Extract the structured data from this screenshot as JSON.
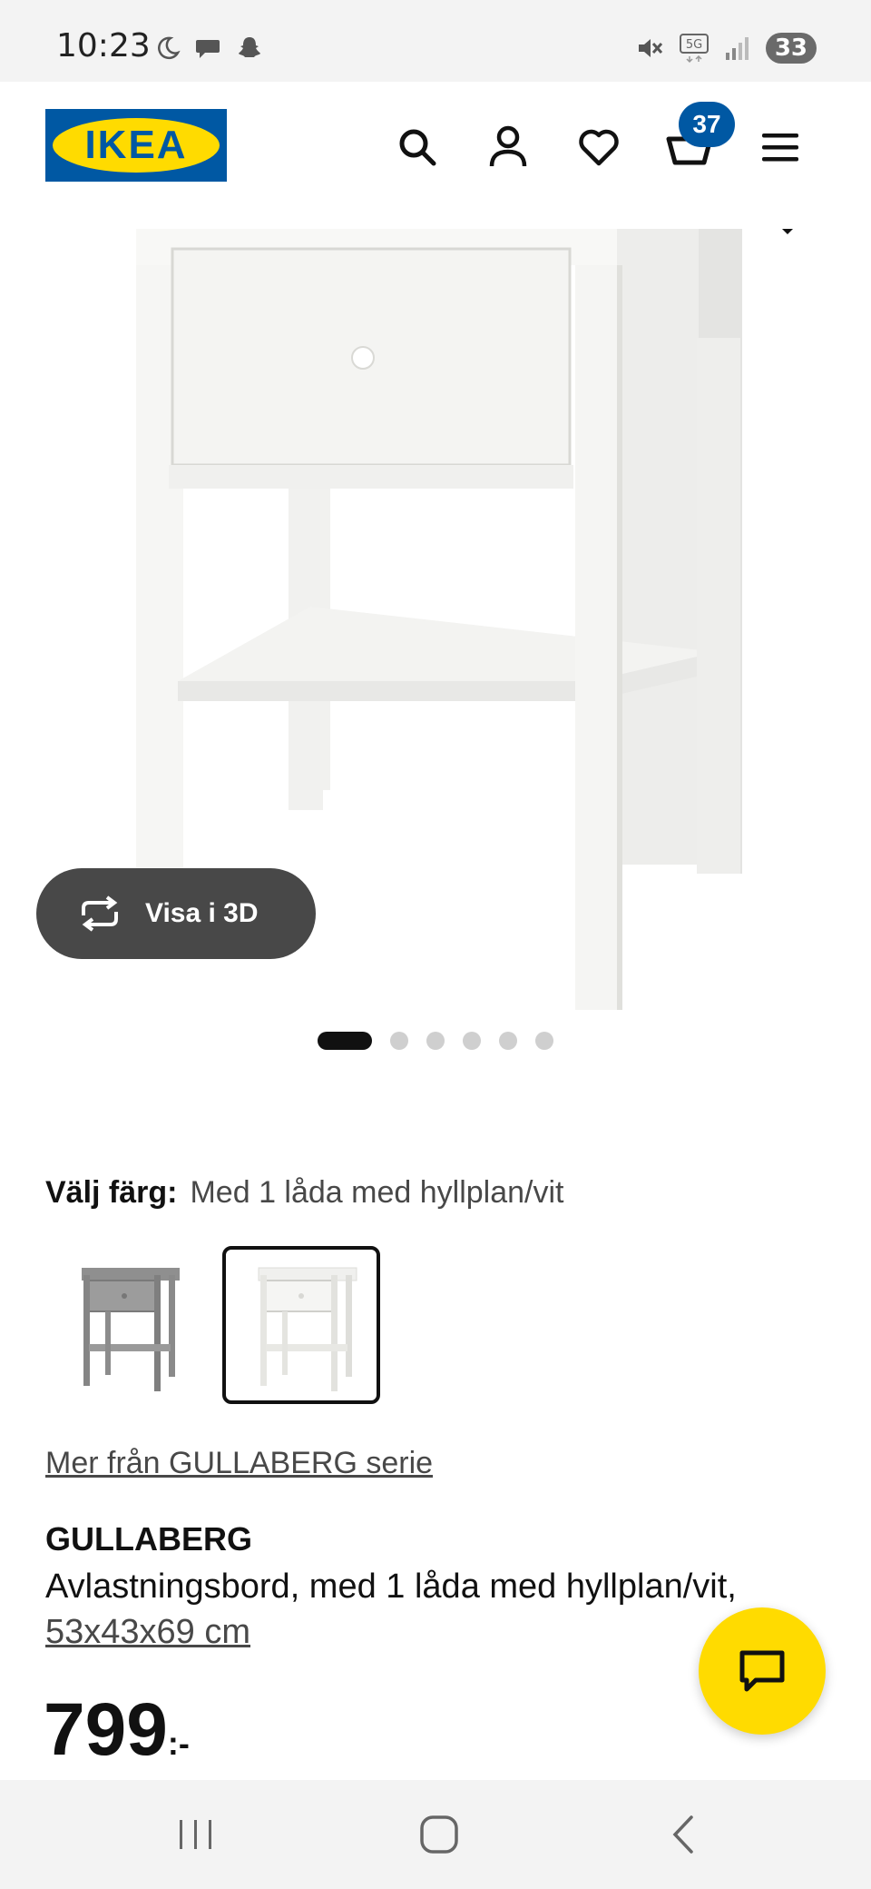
{
  "status_bar": {
    "time": "10:23",
    "battery": "33",
    "network": "5G"
  },
  "header": {
    "logo_text": "IKEA",
    "cart_count": "37",
    "icons": [
      "search-icon",
      "account-icon",
      "heart-icon",
      "cart-icon",
      "menu-icon"
    ]
  },
  "gallery": {
    "view_3d_label": "Visa i 3D",
    "image_count": 6,
    "active_index": 0
  },
  "color_picker": {
    "label": "Välj färg:",
    "selected_value": "Med 1 låda med hyllplan/vit",
    "options": [
      "grey",
      "white"
    ]
  },
  "product": {
    "series_link": "Mer från GULLABERG serie",
    "name": "GULLABERG",
    "description": "Avlastningsbord, med 1 låda med hyllplan/vit,",
    "dimensions": "53x43x69 cm",
    "price": "799",
    "price_suffix": ":-"
  },
  "colors": {
    "brand_blue": "#0058a3",
    "brand_yellow": "#ffdb00",
    "view3d_bg": "#484848"
  }
}
